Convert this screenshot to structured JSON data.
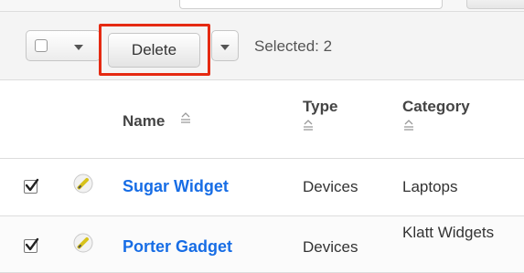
{
  "toolbar": {
    "delete_label": "Delete",
    "selected_text": "Selected: 2"
  },
  "table": {
    "columns": [
      {
        "label": "Name"
      },
      {
        "label": "Type"
      },
      {
        "label": "Category"
      }
    ],
    "rows": [
      {
        "checked": true,
        "name": "Sugar Widget",
        "type": "Devices",
        "category": "Laptops"
      },
      {
        "checked": true,
        "name": "Porter Gadget",
        "type": "Devices",
        "category": "Klatt Widgets"
      }
    ]
  },
  "colors": {
    "link": "#176de5",
    "highlight": "#e52a12"
  },
  "icons": {
    "mass_select": "checkbox-dropdown-icon",
    "row_edit": "pencil-icon",
    "sort": "sort-arrows-icon"
  }
}
